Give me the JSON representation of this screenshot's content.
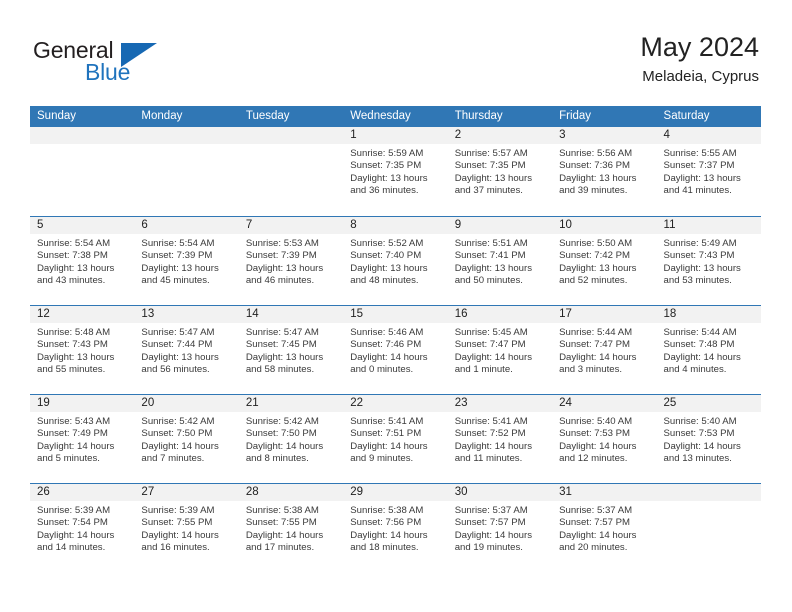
{
  "brand": {
    "name_top": "General",
    "name_bottom": "Blue",
    "accent_color": "#1668b3",
    "logo_icon": "triangle-icon"
  },
  "header": {
    "title": "May 2024",
    "subtitle": "Meladeia, Cyprus"
  },
  "calendar": {
    "header_bg": "#3077b5",
    "daynum_bg": "#f2f2f2",
    "weekday_names": [
      "Sunday",
      "Monday",
      "Tuesday",
      "Wednesday",
      "Thursday",
      "Friday",
      "Saturday"
    ],
    "weeks": [
      [
        {
          "day": "",
          "sunrise": "",
          "sunset": "",
          "daylight_1": "",
          "daylight_2": ""
        },
        {
          "day": "",
          "sunrise": "",
          "sunset": "",
          "daylight_1": "",
          "daylight_2": ""
        },
        {
          "day": "",
          "sunrise": "",
          "sunset": "",
          "daylight_1": "",
          "daylight_2": ""
        },
        {
          "day": "1",
          "sunrise": "Sunrise: 5:59 AM",
          "sunset": "Sunset: 7:35 PM",
          "daylight_1": "Daylight: 13 hours",
          "daylight_2": "and 36 minutes."
        },
        {
          "day": "2",
          "sunrise": "Sunrise: 5:57 AM",
          "sunset": "Sunset: 7:35 PM",
          "daylight_1": "Daylight: 13 hours",
          "daylight_2": "and 37 minutes."
        },
        {
          "day": "3",
          "sunrise": "Sunrise: 5:56 AM",
          "sunset": "Sunset: 7:36 PM",
          "daylight_1": "Daylight: 13 hours",
          "daylight_2": "and 39 minutes."
        },
        {
          "day": "4",
          "sunrise": "Sunrise: 5:55 AM",
          "sunset": "Sunset: 7:37 PM",
          "daylight_1": "Daylight: 13 hours",
          "daylight_2": "and 41 minutes."
        }
      ],
      [
        {
          "day": "5",
          "sunrise": "Sunrise: 5:54 AM",
          "sunset": "Sunset: 7:38 PM",
          "daylight_1": "Daylight: 13 hours",
          "daylight_2": "and 43 minutes."
        },
        {
          "day": "6",
          "sunrise": "Sunrise: 5:54 AM",
          "sunset": "Sunset: 7:39 PM",
          "daylight_1": "Daylight: 13 hours",
          "daylight_2": "and 45 minutes."
        },
        {
          "day": "7",
          "sunrise": "Sunrise: 5:53 AM",
          "sunset": "Sunset: 7:39 PM",
          "daylight_1": "Daylight: 13 hours",
          "daylight_2": "and 46 minutes."
        },
        {
          "day": "8",
          "sunrise": "Sunrise: 5:52 AM",
          "sunset": "Sunset: 7:40 PM",
          "daylight_1": "Daylight: 13 hours",
          "daylight_2": "and 48 minutes."
        },
        {
          "day": "9",
          "sunrise": "Sunrise: 5:51 AM",
          "sunset": "Sunset: 7:41 PM",
          "daylight_1": "Daylight: 13 hours",
          "daylight_2": "and 50 minutes."
        },
        {
          "day": "10",
          "sunrise": "Sunrise: 5:50 AM",
          "sunset": "Sunset: 7:42 PM",
          "daylight_1": "Daylight: 13 hours",
          "daylight_2": "and 52 minutes."
        },
        {
          "day": "11",
          "sunrise": "Sunrise: 5:49 AM",
          "sunset": "Sunset: 7:43 PM",
          "daylight_1": "Daylight: 13 hours",
          "daylight_2": "and 53 minutes."
        }
      ],
      [
        {
          "day": "12",
          "sunrise": "Sunrise: 5:48 AM",
          "sunset": "Sunset: 7:43 PM",
          "daylight_1": "Daylight: 13 hours",
          "daylight_2": "and 55 minutes."
        },
        {
          "day": "13",
          "sunrise": "Sunrise: 5:47 AM",
          "sunset": "Sunset: 7:44 PM",
          "daylight_1": "Daylight: 13 hours",
          "daylight_2": "and 56 minutes."
        },
        {
          "day": "14",
          "sunrise": "Sunrise: 5:47 AM",
          "sunset": "Sunset: 7:45 PM",
          "daylight_1": "Daylight: 13 hours",
          "daylight_2": "and 58 minutes."
        },
        {
          "day": "15",
          "sunrise": "Sunrise: 5:46 AM",
          "sunset": "Sunset: 7:46 PM",
          "daylight_1": "Daylight: 14 hours",
          "daylight_2": "and 0 minutes."
        },
        {
          "day": "16",
          "sunrise": "Sunrise: 5:45 AM",
          "sunset": "Sunset: 7:47 PM",
          "daylight_1": "Daylight: 14 hours",
          "daylight_2": "and 1 minute."
        },
        {
          "day": "17",
          "sunrise": "Sunrise: 5:44 AM",
          "sunset": "Sunset: 7:47 PM",
          "daylight_1": "Daylight: 14 hours",
          "daylight_2": "and 3 minutes."
        },
        {
          "day": "18",
          "sunrise": "Sunrise: 5:44 AM",
          "sunset": "Sunset: 7:48 PM",
          "daylight_1": "Daylight: 14 hours",
          "daylight_2": "and 4 minutes."
        }
      ],
      [
        {
          "day": "19",
          "sunrise": "Sunrise: 5:43 AM",
          "sunset": "Sunset: 7:49 PM",
          "daylight_1": "Daylight: 14 hours",
          "daylight_2": "and 5 minutes."
        },
        {
          "day": "20",
          "sunrise": "Sunrise: 5:42 AM",
          "sunset": "Sunset: 7:50 PM",
          "daylight_1": "Daylight: 14 hours",
          "daylight_2": "and 7 minutes."
        },
        {
          "day": "21",
          "sunrise": "Sunrise: 5:42 AM",
          "sunset": "Sunset: 7:50 PM",
          "daylight_1": "Daylight: 14 hours",
          "daylight_2": "and 8 minutes."
        },
        {
          "day": "22",
          "sunrise": "Sunrise: 5:41 AM",
          "sunset": "Sunset: 7:51 PM",
          "daylight_1": "Daylight: 14 hours",
          "daylight_2": "and 9 minutes."
        },
        {
          "day": "23",
          "sunrise": "Sunrise: 5:41 AM",
          "sunset": "Sunset: 7:52 PM",
          "daylight_1": "Daylight: 14 hours",
          "daylight_2": "and 11 minutes."
        },
        {
          "day": "24",
          "sunrise": "Sunrise: 5:40 AM",
          "sunset": "Sunset: 7:53 PM",
          "daylight_1": "Daylight: 14 hours",
          "daylight_2": "and 12 minutes."
        },
        {
          "day": "25",
          "sunrise": "Sunrise: 5:40 AM",
          "sunset": "Sunset: 7:53 PM",
          "daylight_1": "Daylight: 14 hours",
          "daylight_2": "and 13 minutes."
        }
      ],
      [
        {
          "day": "26",
          "sunrise": "Sunrise: 5:39 AM",
          "sunset": "Sunset: 7:54 PM",
          "daylight_1": "Daylight: 14 hours",
          "daylight_2": "and 14 minutes."
        },
        {
          "day": "27",
          "sunrise": "Sunrise: 5:39 AM",
          "sunset": "Sunset: 7:55 PM",
          "daylight_1": "Daylight: 14 hours",
          "daylight_2": "and 16 minutes."
        },
        {
          "day": "28",
          "sunrise": "Sunrise: 5:38 AM",
          "sunset": "Sunset: 7:55 PM",
          "daylight_1": "Daylight: 14 hours",
          "daylight_2": "and 17 minutes."
        },
        {
          "day": "29",
          "sunrise": "Sunrise: 5:38 AM",
          "sunset": "Sunset: 7:56 PM",
          "daylight_1": "Daylight: 14 hours",
          "daylight_2": "and 18 minutes."
        },
        {
          "day": "30",
          "sunrise": "Sunrise: 5:37 AM",
          "sunset": "Sunset: 7:57 PM",
          "daylight_1": "Daylight: 14 hours",
          "daylight_2": "and 19 minutes."
        },
        {
          "day": "31",
          "sunrise": "Sunrise: 5:37 AM",
          "sunset": "Sunset: 7:57 PM",
          "daylight_1": "Daylight: 14 hours",
          "daylight_2": "and 20 minutes."
        },
        {
          "day": "",
          "sunrise": "",
          "sunset": "",
          "daylight_1": "",
          "daylight_2": ""
        }
      ]
    ]
  }
}
